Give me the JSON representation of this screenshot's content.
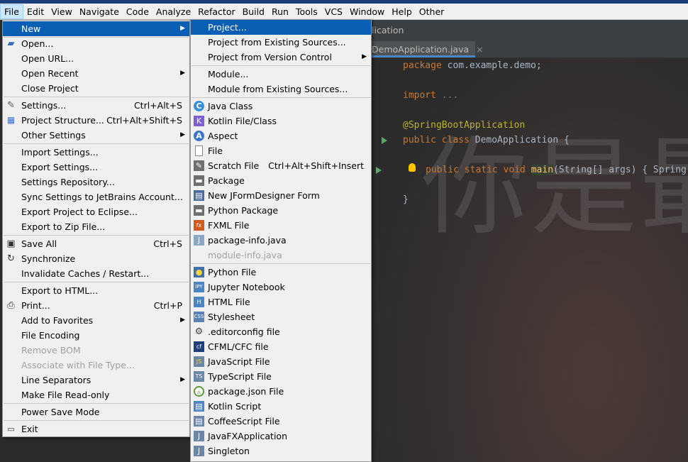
{
  "menubar": [
    "File",
    "Edit",
    "View",
    "Navigate",
    "Code",
    "Analyze",
    "Refactor",
    "Build",
    "Run",
    "Tools",
    "VCS",
    "Window",
    "Help",
    "Other"
  ],
  "editor": {
    "breadcrumb": "lication",
    "tab_name": "DemoApplication.java",
    "tab_close": "×",
    "code": {
      "line1_kw": "package",
      "line1_rest": " com.example.demo;",
      "line2_kw": "import",
      "line2_rest": " ...",
      "line3": "@SpringBootApplication",
      "line4_kw": "public class",
      "line4_rest": " DemoApplication {",
      "line5_kw": "public static void",
      "line5_method": "main",
      "line5_rest": "(String[] args) { Spring",
      "line6": "}"
    },
    "watermark": "你是最"
  },
  "file_menu": {
    "items": [
      {
        "label": "New",
        "arrow": true,
        "highlight": true
      },
      {
        "label": "Open...",
        "icon": "folder-icon"
      },
      {
        "label": "Open URL..."
      },
      {
        "label": "Open Recent",
        "arrow": true
      },
      {
        "label": "Close Project"
      },
      {
        "label": "Settings...",
        "shortcut": "Ctrl+Alt+S",
        "icon": "wrench-icon"
      },
      {
        "label": "Project Structure...",
        "shortcut": "Ctrl+Alt+Shift+S",
        "icon": "project-structure-icon"
      },
      {
        "label": "Other Settings",
        "arrow": true
      },
      {
        "label": "Import Settings..."
      },
      {
        "label": "Export Settings..."
      },
      {
        "label": "Settings Repository..."
      },
      {
        "label": "Sync Settings to JetBrains Account..."
      },
      {
        "label": "Export Project to Eclipse..."
      },
      {
        "label": "Export to Zip File..."
      },
      {
        "label": "Save All",
        "shortcut": "Ctrl+S",
        "icon": "save-icon"
      },
      {
        "label": "Synchronize",
        "icon": "sync-icon"
      },
      {
        "label": "Invalidate Caches / Restart..."
      },
      {
        "label": "Export to HTML..."
      },
      {
        "label": "Print...",
        "shortcut": "Ctrl+P",
        "icon": "print-icon"
      },
      {
        "label": "Add to Favorites",
        "arrow": true
      },
      {
        "label": "File Encoding"
      },
      {
        "label": "Remove BOM",
        "disabled": true
      },
      {
        "label": "Associate with File Type...",
        "disabled": true
      },
      {
        "label": "Line Separators",
        "arrow": true
      },
      {
        "label": "Make File Read-only"
      },
      {
        "label": "Power Save Mode"
      },
      {
        "label": "Exit",
        "icon": "exit-icon"
      }
    ]
  },
  "new_menu": {
    "items": [
      {
        "label": "Project...",
        "highlight": true
      },
      {
        "label": "Project from Existing Sources..."
      },
      {
        "label": "Project from Version Control",
        "arrow": true
      },
      {
        "label": "Module..."
      },
      {
        "label": "Module from Existing Sources..."
      },
      {
        "label": "Java Class",
        "icon": "java-class-icon",
        "glyph": "C"
      },
      {
        "label": "Kotlin File/Class",
        "icon": "kotlin-icon",
        "glyph": "K"
      },
      {
        "label": "Aspect",
        "icon": "aspect-icon",
        "glyph": "A"
      },
      {
        "label": "File",
        "icon": "file-icon"
      },
      {
        "label": "Scratch File",
        "shortcut": "Ctrl+Alt+Shift+Insert",
        "icon": "scratch-file-icon"
      },
      {
        "label": "Package",
        "icon": "package-icon"
      },
      {
        "label": "New JFormDesigner Form",
        "icon": "form-icon"
      },
      {
        "label": "Python Package",
        "icon": "python-package-icon"
      },
      {
        "label": "FXML File",
        "icon": "fxml-icon",
        "glyph": "fx"
      },
      {
        "label": "package-info.java",
        "icon": "java-file-icon",
        "glyph": "J"
      },
      {
        "label": "module-info.java",
        "disabled": true
      },
      {
        "label": "Python File",
        "icon": "python-icon"
      },
      {
        "label": "Jupyter Notebook",
        "icon": "jupyter-icon",
        "glyph": "IPY"
      },
      {
        "label": "HTML File",
        "icon": "html-icon",
        "glyph": "H"
      },
      {
        "label": "Stylesheet",
        "icon": "css-icon",
        "glyph": "CSS"
      },
      {
        "label": ".editorconfig file",
        "icon": "gear-icon"
      },
      {
        "label": "CFML/CFC file",
        "icon": "cfml-icon",
        "glyph": "cf"
      },
      {
        "label": "JavaScript File",
        "icon": "javascript-icon",
        "glyph": "JS"
      },
      {
        "label": "TypeScript File",
        "icon": "typescript-icon",
        "glyph": "TS"
      },
      {
        "label": "package.json File",
        "icon": "npm-icon",
        "glyph": "n"
      },
      {
        "label": "Kotlin Script",
        "icon": "kotlin-script-icon"
      },
      {
        "label": "CoffeeScript File",
        "icon": "coffeescript-icon"
      },
      {
        "label": "JavaFXApplication",
        "icon": "javafx-icon",
        "glyph": "J"
      },
      {
        "label": "Singleton",
        "icon": "singleton-icon",
        "glyph": "J"
      }
    ]
  }
}
